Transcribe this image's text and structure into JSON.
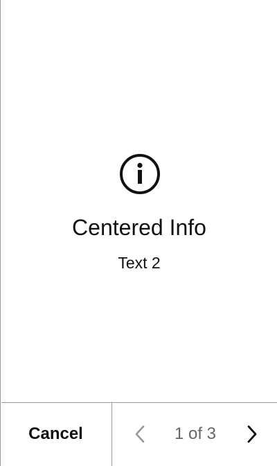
{
  "main": {
    "icon": "info-circle-icon",
    "title": "Centered Info",
    "subtitle": "Text 2"
  },
  "footer": {
    "cancel_label": "Cancel",
    "pager": {
      "prev_icon": "chevron-left-icon",
      "next_icon": "chevron-right-icon",
      "label": "1 of 3",
      "prev_enabled": false,
      "next_enabled": true
    }
  },
  "colors": {
    "text": "#111111",
    "muted_text": "#666666",
    "disabled_icon": "#999999",
    "border": "#9a9a9a",
    "background": "#ffffff"
  }
}
